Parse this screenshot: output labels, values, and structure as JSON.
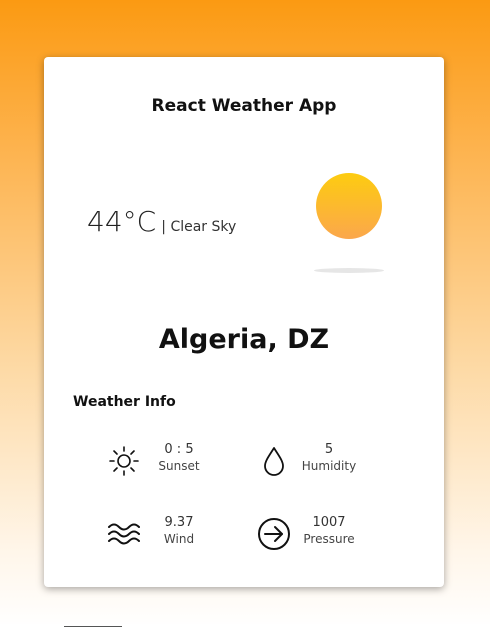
{
  "app": {
    "title": "React Weather App"
  },
  "current": {
    "temperature": "44°C",
    "condition": "| Clear Sky",
    "city": "Algeria, DZ"
  },
  "weather_info": {
    "title": "Weather Info",
    "items": [
      {
        "value": "0 : 5",
        "label": "Sunset",
        "icon": "sun-icon"
      },
      {
        "value": "5",
        "label": "Humidity",
        "icon": "drop-icon"
      },
      {
        "value": "9.37",
        "label": "Wind",
        "icon": "wind-icon"
      },
      {
        "value": "1007",
        "label": "Pressure",
        "icon": "arrow-circle-icon"
      }
    ]
  },
  "colors": {
    "background_top": "#fb9a12",
    "background_bottom": "#ffffff",
    "sun_top": "#fdcc10",
    "sun_bottom": "#fba74c"
  }
}
